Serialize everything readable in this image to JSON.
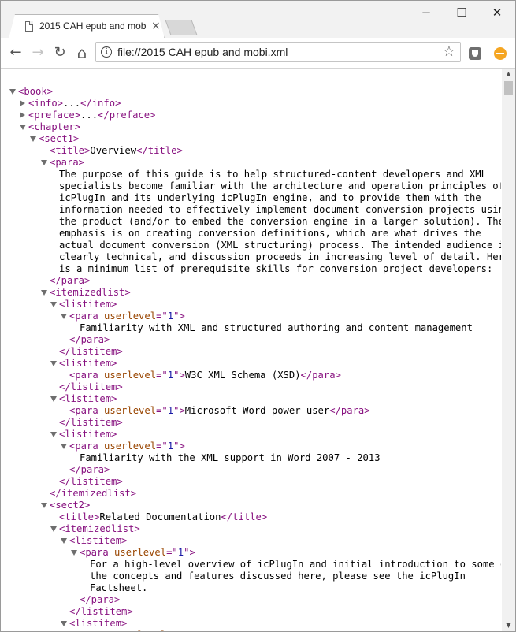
{
  "browser": {
    "tab_title": "2015 CAH epub and mobi.xml",
    "url": "file://2015 CAH epub and mobi.xml",
    "window_controls": [
      "minimize-icon",
      "maximize-icon",
      "close-icon"
    ],
    "tab_close_glyph": "×",
    "min_glyph": "−",
    "max_glyph": "☐",
    "close_glyph": "✕",
    "back_glyph": "←",
    "forward_glyph": "→",
    "reload_glyph": "↻",
    "home_glyph": "⌂",
    "star_glyph": "☆",
    "info_glyph": "i"
  },
  "xml_lines": [
    {
      "t": "open",
      "parts": [
        [
          "tag",
          "<book>"
        ]
      ]
    },
    {
      "t": "closed",
      "parts": [
        [
          "tag",
          "<info>"
        ],
        [
          "txt",
          "..."
        ],
        [
          "tag",
          "</info>"
        ]
      ]
    },
    {
      "t": "closed",
      "parts": [
        [
          "tag",
          "<preface>"
        ],
        [
          "txt",
          "..."
        ],
        [
          "tag",
          "</preface>"
        ]
      ]
    },
    {
      "t": "open",
      "parts": [
        [
          "tag",
          "<chapter>"
        ]
      ]
    },
    {
      "t": "open",
      "parts": [
        [
          "tag",
          "<sect1>"
        ]
      ]
    },
    {
      "t": "none",
      "parts": [
        [
          "tag",
          "<title>"
        ],
        [
          "txt",
          "Overview"
        ],
        [
          "tag",
          "</title>"
        ]
      ]
    },
    {
      "t": "open",
      "parts": [
        [
          "tag",
          "<para>"
        ]
      ]
    },
    {
      "t": "none",
      "parts": [
        [
          "txt",
          "The purpose of this guide is to help structured-content developers and XML"
        ]
      ]
    },
    {
      "t": "none",
      "parts": [
        [
          "txt",
          "specialists become familiar with the architecture and operation principles of"
        ]
      ]
    },
    {
      "t": "none",
      "parts": [
        [
          "txt",
          "icPlugIn and its underlying icPlugIn engine, and to provide them with the"
        ]
      ]
    },
    {
      "t": "none",
      "parts": [
        [
          "txt",
          "information needed to effectively implement document conversion projects using"
        ]
      ]
    },
    {
      "t": "none",
      "parts": [
        [
          "txt",
          "the product (and/or to embed the conversion engine in a larger solution). The"
        ]
      ]
    },
    {
      "t": "none",
      "parts": [
        [
          "txt",
          "emphasis is on creating conversion definitions, which are what drives the"
        ]
      ]
    },
    {
      "t": "none",
      "parts": [
        [
          "txt",
          "actual document conversion (XML structuring) process. The intended audience is"
        ]
      ]
    },
    {
      "t": "none",
      "parts": [
        [
          "txt",
          "clearly technical, and discussion proceeds in increasing level of detail. Here"
        ]
      ]
    },
    {
      "t": "none",
      "parts": [
        [
          "txt",
          "is a minimum list of prerequisite skills for conversion project developers:"
        ]
      ]
    },
    {
      "t": "none",
      "parts": [
        [
          "tag",
          "</para>"
        ]
      ]
    },
    {
      "t": "open",
      "parts": [
        [
          "tag",
          "<itemizedlist>"
        ]
      ]
    },
    {
      "t": "open",
      "parts": [
        [
          "tag",
          "<listitem>"
        ]
      ]
    },
    {
      "t": "open",
      "parts": [
        [
          "tag",
          "<para "
        ],
        [
          "attr",
          "userlevel"
        ],
        [
          "tag",
          "=\""
        ],
        [
          "val",
          "1"
        ],
        [
          "tag",
          "\">"
        ]
      ]
    },
    {
      "t": "none",
      "parts": [
        [
          "txt",
          "Familiarity with XML and structured authoring and content management"
        ]
      ]
    },
    {
      "t": "none",
      "parts": [
        [
          "tag",
          "</para>"
        ]
      ]
    },
    {
      "t": "none",
      "parts": [
        [
          "tag",
          "</listitem>"
        ]
      ]
    },
    {
      "t": "open",
      "parts": [
        [
          "tag",
          "<listitem>"
        ]
      ]
    },
    {
      "t": "none",
      "parts": [
        [
          "tag",
          "<para "
        ],
        [
          "attr",
          "userlevel"
        ],
        [
          "tag",
          "=\""
        ],
        [
          "val",
          "1"
        ],
        [
          "tag",
          "\">"
        ],
        [
          "txt",
          "W3C XML Schema (XSD)"
        ],
        [
          "tag",
          "</para>"
        ]
      ]
    },
    {
      "t": "none",
      "parts": [
        [
          "tag",
          "</listitem>"
        ]
      ]
    },
    {
      "t": "open",
      "parts": [
        [
          "tag",
          "<listitem>"
        ]
      ]
    },
    {
      "t": "none",
      "parts": [
        [
          "tag",
          "<para "
        ],
        [
          "attr",
          "userlevel"
        ],
        [
          "tag",
          "=\""
        ],
        [
          "val",
          "1"
        ],
        [
          "tag",
          "\">"
        ],
        [
          "txt",
          "Microsoft Word power user"
        ],
        [
          "tag",
          "</para>"
        ]
      ]
    },
    {
      "t": "none",
      "parts": [
        [
          "tag",
          "</listitem>"
        ]
      ]
    },
    {
      "t": "open",
      "parts": [
        [
          "tag",
          "<listitem>"
        ]
      ]
    },
    {
      "t": "open",
      "parts": [
        [
          "tag",
          "<para "
        ],
        [
          "attr",
          "userlevel"
        ],
        [
          "tag",
          "=\""
        ],
        [
          "val",
          "1"
        ],
        [
          "tag",
          "\">"
        ]
      ]
    },
    {
      "t": "none",
      "parts": [
        [
          "txt",
          "Familiarity with the XML support in Word 2007 - 2013"
        ]
      ]
    },
    {
      "t": "none",
      "parts": [
        [
          "tag",
          "</para>"
        ]
      ]
    },
    {
      "t": "none",
      "parts": [
        [
          "tag",
          "</listitem>"
        ]
      ]
    },
    {
      "t": "none",
      "parts": [
        [
          "tag",
          "</itemizedlist>"
        ]
      ]
    },
    {
      "t": "open",
      "parts": [
        [
          "tag",
          "<sect2>"
        ]
      ]
    },
    {
      "t": "none",
      "parts": [
        [
          "tag",
          "<title>"
        ],
        [
          "txt",
          "Related Documentation"
        ],
        [
          "tag",
          "</title>"
        ]
      ]
    },
    {
      "t": "open",
      "parts": [
        [
          "tag",
          "<itemizedlist>"
        ]
      ]
    },
    {
      "t": "open",
      "parts": [
        [
          "tag",
          "<listitem>"
        ]
      ]
    },
    {
      "t": "open",
      "parts": [
        [
          "tag",
          "<para "
        ],
        [
          "attr",
          "userlevel"
        ],
        [
          "tag",
          "=\""
        ],
        [
          "val",
          "1"
        ],
        [
          "tag",
          "\">"
        ]
      ]
    },
    {
      "t": "none",
      "parts": [
        [
          "txt",
          "For a high-level overview of icPlugIn and initial introduction to some of"
        ]
      ]
    },
    {
      "t": "none",
      "parts": [
        [
          "txt",
          "the concepts and features discussed here, please see the icPlugIn"
        ]
      ]
    },
    {
      "t": "none",
      "parts": [
        [
          "txt",
          "Factsheet."
        ]
      ]
    },
    {
      "t": "none",
      "parts": [
        [
          "tag",
          "</para>"
        ]
      ]
    },
    {
      "t": "none",
      "parts": [
        [
          "tag",
          "</listitem>"
        ]
      ]
    },
    {
      "t": "open",
      "parts": [
        [
          "tag",
          "<listitem>"
        ]
      ]
    },
    {
      "t": "open",
      "parts": [
        [
          "tag",
          "<para "
        ],
        [
          "attr",
          "userlevel"
        ],
        [
          "tag",
          "=\""
        ],
        [
          "val",
          "1"
        ],
        [
          "tag",
          "\">"
        ]
      ]
    }
  ]
}
